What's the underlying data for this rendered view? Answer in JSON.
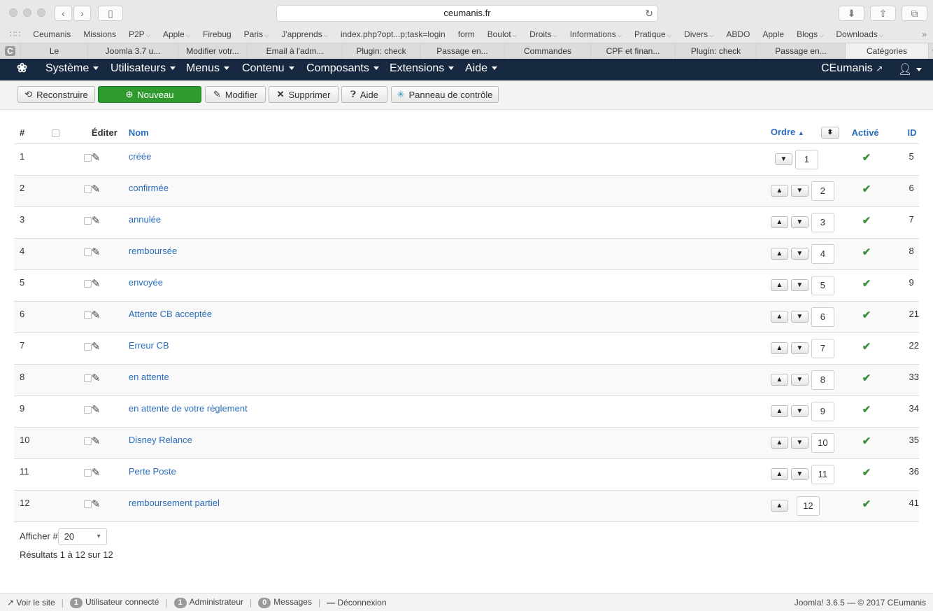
{
  "browser": {
    "url": "ceumanis.fr",
    "bookmarks": [
      {
        "label": "Ceumanis",
        "dd": false
      },
      {
        "label": "Missions",
        "dd": false
      },
      {
        "label": "P2P",
        "dd": true
      },
      {
        "label": "Apple",
        "dd": true
      },
      {
        "label": "Firebug",
        "dd": false
      },
      {
        "label": "Paris",
        "dd": true
      },
      {
        "label": "J'apprends",
        "dd": true
      },
      {
        "label": "index.php?opt...p;task=login",
        "dd": false
      },
      {
        "label": "form",
        "dd": false
      },
      {
        "label": "Boulot",
        "dd": true
      },
      {
        "label": "Droits",
        "dd": true
      },
      {
        "label": "Informations",
        "dd": true
      },
      {
        "label": "Pratique",
        "dd": true
      },
      {
        "label": "Divers",
        "dd": true
      },
      {
        "label": "ABDO",
        "dd": false
      },
      {
        "label": "Apple",
        "dd": false
      },
      {
        "label": "Blogs",
        "dd": true
      },
      {
        "label": "Downloads",
        "dd": true
      }
    ],
    "tabs": [
      "Le",
      "Joomla 3.7 u...",
      "Modifier votr...",
      "Email à l'adm...",
      "Plugin: check",
      "Passage en...",
      "Commandes",
      "CPF et finan...",
      "Plugin: check",
      "Passage en...",
      "Catégories"
    ]
  },
  "admin_nav": {
    "menus": [
      "Système",
      "Utilisateurs",
      "Menus",
      "Contenu",
      "Composants",
      "Extensions",
      "Aide"
    ],
    "site_link": "CEumanis"
  },
  "toolbar": {
    "rebuild": "Reconstruire",
    "new": "Nouveau",
    "edit": "Modifier",
    "delete": "Supprimer",
    "help": "Aide",
    "control_panel": "Panneau de contrôle"
  },
  "table": {
    "headers": {
      "num": "#",
      "edit": "Éditer",
      "name": "Nom",
      "order": "Ordre",
      "active": "Activé",
      "id": "ID"
    },
    "rows": [
      {
        "num": "1",
        "name": "créée",
        "order": "1",
        "id": "5"
      },
      {
        "num": "2",
        "name": "confirmée",
        "order": "2",
        "id": "6"
      },
      {
        "num": "3",
        "name": "annulée",
        "order": "3",
        "id": "7"
      },
      {
        "num": "4",
        "name": "remboursée",
        "order": "4",
        "id": "8"
      },
      {
        "num": "5",
        "name": "envoyée",
        "order": "5",
        "id": "9"
      },
      {
        "num": "6",
        "name": "Attente CB acceptée",
        "order": "6",
        "id": "21"
      },
      {
        "num": "7",
        "name": "Erreur CB",
        "order": "7",
        "id": "22"
      },
      {
        "num": "8",
        "name": "en attente",
        "order": "8",
        "id": "33"
      },
      {
        "num": "9",
        "name": "en attente de votre règlement",
        "order": "9",
        "id": "34"
      },
      {
        "num": "10",
        "name": "Disney Relance",
        "order": "10",
        "id": "35"
      },
      {
        "num": "11",
        "name": "Perte Poste",
        "order": "11",
        "id": "36"
      },
      {
        "num": "12",
        "name": "remboursement partiel",
        "order": "12",
        "id": "41"
      }
    ]
  },
  "pagination": {
    "limit_label": "Afficher #",
    "limit_value": "20",
    "results": "Résultats 1 à 12 sur 12"
  },
  "status_bar": {
    "view_site": "Voir le site",
    "users_count": "1",
    "users_label": "Utilisateur connecté",
    "admin_count": "1",
    "admin_label": "Administrateur",
    "messages_count": "0",
    "messages_label": "Messages",
    "logout": "Déconnexion",
    "version": "Joomla! 3.6.5  —  © 2017 CEumanis"
  }
}
